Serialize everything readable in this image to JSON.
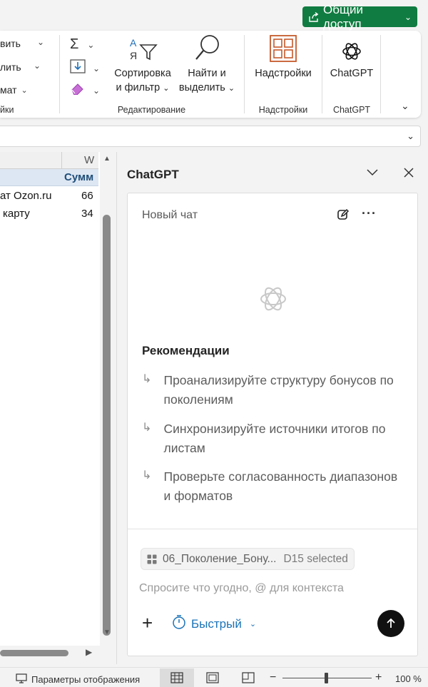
{
  "header": {
    "share_label": "Общий доступ"
  },
  "ribbon": {
    "left_partial": {
      "item1": "вить",
      "item2": "лить",
      "item3": "мат",
      "group_label_partial": "йки"
    },
    "editing": {
      "sort_filter_line1": "Сортировка",
      "sort_filter_line2": "и фильтр",
      "find_select_line1": "Найти и",
      "find_select_line2": "выделить",
      "group_label": "Редактирование"
    },
    "addins": {
      "button_label": "Надстройки",
      "group_label": "Надстройки"
    },
    "chatgpt": {
      "button_label": "ChatGPT",
      "group_label": "ChatGPT"
    }
  },
  "sheet": {
    "column_letter": "W",
    "header_cell": "Сумм",
    "rows": [
      {
        "label": "ат Ozon.ru",
        "value": "66"
      },
      {
        "label": "карту",
        "value": "34"
      }
    ]
  },
  "pane": {
    "title": "ChatGPT",
    "new_chat": "Новый чат",
    "recommendations_title": "Рекомендации",
    "recommendations": [
      "Проанализируйте структуру бонусов по поколениям",
      "Синхронизируйте источники итогов по листам",
      "Проверьте согласованность диапазонов и форматов"
    ],
    "context_file": "06_Поколение_Бону...",
    "context_selection": "D15 selected",
    "input_placeholder": "Спросите что угодно, @ для контекста",
    "input_value": "",
    "mode_label": "Быстрый"
  },
  "status": {
    "display_params": "Параметры отображения",
    "zoom": "100 %"
  },
  "colors": {
    "share_green": "#107c41",
    "addins_orange": "#c55a2b",
    "mode_blue": "#1a73b8"
  }
}
